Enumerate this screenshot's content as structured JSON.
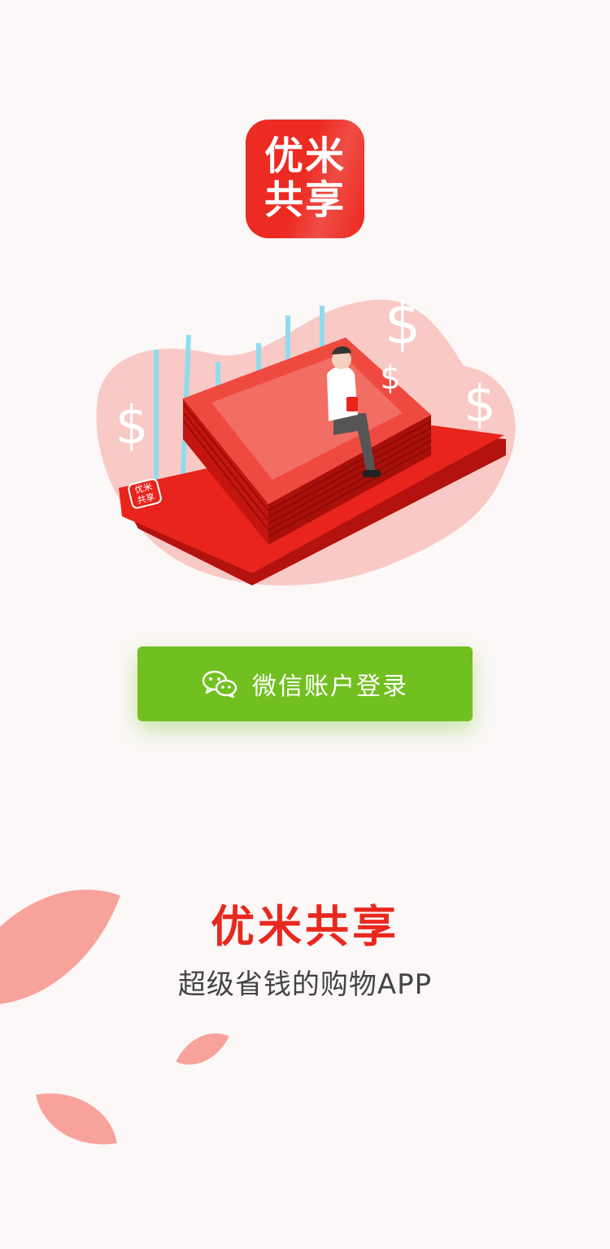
{
  "logo": {
    "line1": "优米",
    "line2": "共享"
  },
  "illustration": {
    "phone_badge_line1": "优米",
    "phone_badge_line2": "共享",
    "currency_symbol": "$"
  },
  "login_button": {
    "label": "微信账户登录",
    "icon": "wechat-icon"
  },
  "footer": {
    "brand": "优米共享",
    "slogan": "超级省钱的购物APP"
  },
  "colors": {
    "brand_red": "#ec2b22",
    "wechat_green": "#72c020",
    "petal": "#f7a39c",
    "background": "#fbf8f7"
  }
}
